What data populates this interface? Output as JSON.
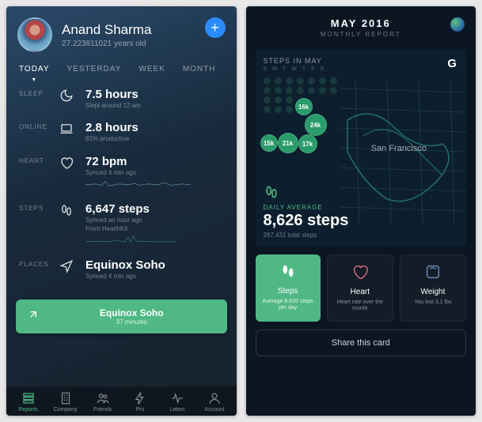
{
  "phone1": {
    "user": {
      "name": "Anand Sharma",
      "age": "27.223811021 years old"
    },
    "tabs": [
      "TODAY",
      "YESTERDAY",
      "WEEK",
      "MONTH"
    ],
    "metrics": {
      "sleep": {
        "label": "SLEEP",
        "value": "7.5 hours",
        "sub": "Slept around 12 am"
      },
      "online": {
        "label": "ONLINE",
        "value": "2.8 hours",
        "sub": "81% productive"
      },
      "heart": {
        "label": "HEART",
        "value": "72 bpm",
        "sub": "Synced 4 min ago"
      },
      "steps": {
        "label": "STEPS",
        "value": "6,647 steps",
        "sub": "Synced an hour ago\nFrom HealthKit"
      },
      "places": {
        "label": "PLACES",
        "value": "Equinox Soho",
        "sub": "Synced 4 min ago"
      }
    },
    "checkin": {
      "title": "Equinox Soho",
      "sub": "37 minutes"
    },
    "nav": {
      "reports": "Reports",
      "company": "Company",
      "friends": "Friends",
      "pro": "Pro",
      "latest": "Latest",
      "account": "Account"
    }
  },
  "phone2": {
    "header": {
      "month": "MAY 2016",
      "sub": "MONTHLY REPORT"
    },
    "steps_in": "STEPS IN MAY",
    "days": [
      "S",
      "M",
      "T",
      "W",
      "T",
      "F",
      "S"
    ],
    "bubbles": {
      "b1": "15k",
      "b2": "21k",
      "b3": "17k",
      "b4": "16k",
      "b5": "24k"
    },
    "city": "San Francisco",
    "daily": {
      "label": "DAILY AVERAGE",
      "value": "8,626 steps",
      "total": "267,431 total steps"
    },
    "cards": {
      "steps": {
        "title": "Steps",
        "sub": "Average 8,626 steps per day"
      },
      "heart": {
        "title": "Heart",
        "sub": "Heart rate over the month"
      },
      "weight": {
        "title": "Weight",
        "sub": "You lost 3.1 lbs"
      }
    },
    "share": "Share this card"
  }
}
